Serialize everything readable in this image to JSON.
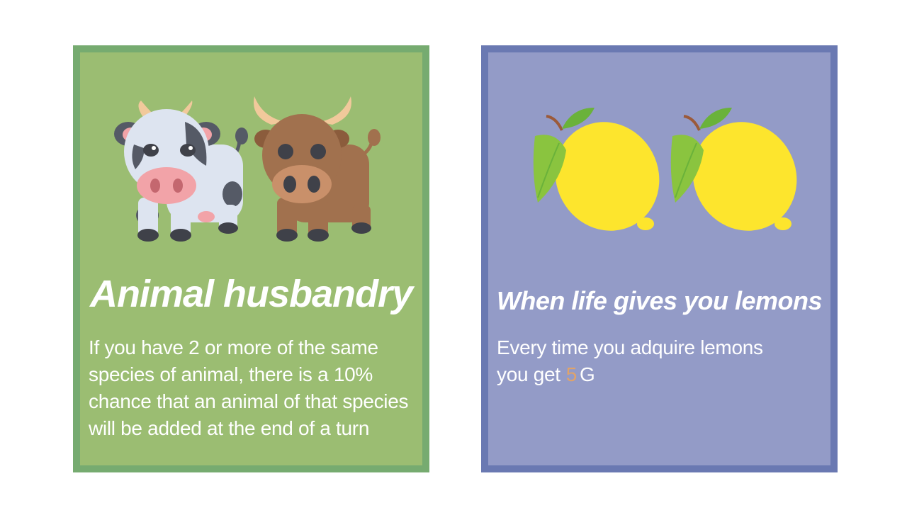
{
  "cards": [
    {
      "id": "animal-husbandry",
      "title": "Animal husbandry",
      "body_lines": [
        "If you have 2 or more of the same",
        "species of animal, there is a 10%",
        "chance that an animal of that species",
        "will be added at the end of a turn"
      ],
      "art": [
        "cow-icon",
        "ox-icon"
      ],
      "colors": {
        "background": "#9bbd72",
        "border": "#76ab70"
      }
    },
    {
      "id": "when-life-gives-you-lemons",
      "title": "When life gives you lemons",
      "body_lines": [
        "Every time you adquire lemons",
        "you get"
      ],
      "reward": {
        "amount": "5",
        "unit": "G"
      },
      "art": [
        "lemon-icon",
        "lemon-icon"
      ],
      "colors": {
        "background": "#939bc7",
        "border": "#6a79b2",
        "reward_amount": "#e0a36a"
      }
    }
  ]
}
